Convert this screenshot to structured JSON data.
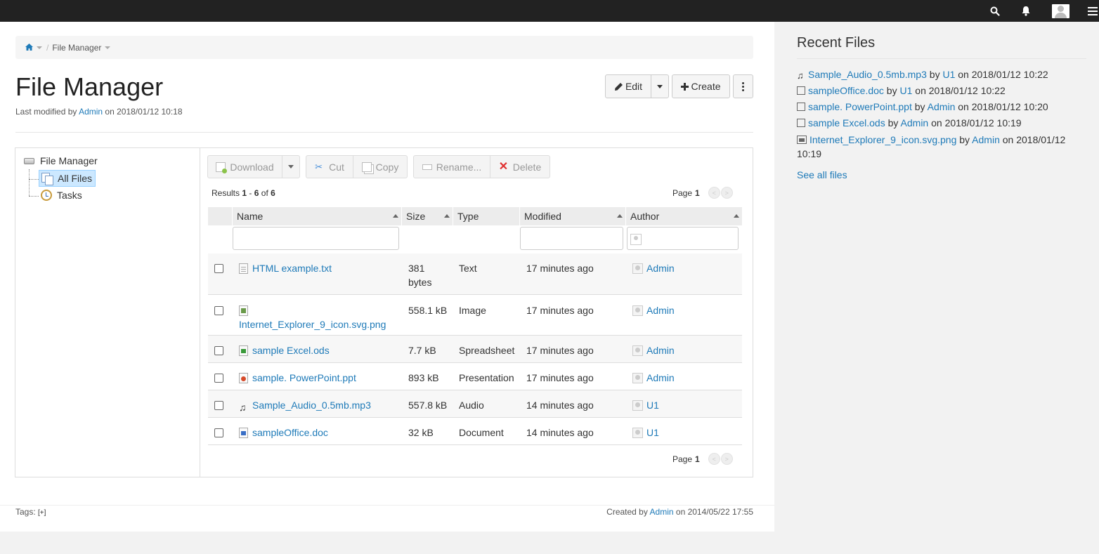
{
  "topbar": {
    "icons": [
      "search-icon",
      "bell-icon",
      "user-avatar",
      "menu-icon"
    ]
  },
  "breadcrumb": {
    "home_icon": "home-icon",
    "separator": "/",
    "current": "File Manager"
  },
  "page": {
    "title": "File Manager",
    "lastmod_prefix": "Last modified by",
    "lastmod_user": "Admin",
    "lastmod_suffix": "on 2018/01/12 10:18"
  },
  "actions": {
    "edit": "Edit",
    "create": "Create"
  },
  "tree": {
    "root": "File Manager",
    "items": [
      {
        "label": "All Files",
        "icon": "files-icon",
        "selected": true
      },
      {
        "label": "Tasks",
        "icon": "clock-icon",
        "selected": false
      }
    ]
  },
  "toolbar": {
    "download": "Download",
    "cut": "Cut",
    "copy": "Copy",
    "rename": "Rename...",
    "delete": "Delete"
  },
  "results": {
    "prefix": "Results",
    "from": "1",
    "dash": "-",
    "to": "6",
    "of": "of",
    "total": "6"
  },
  "pager": {
    "label": "Page",
    "page": "1",
    "prev": "<",
    "next": ">"
  },
  "table": {
    "columns": [
      "Name",
      "Size",
      "Type",
      "Modified",
      "Author"
    ],
    "rows": [
      {
        "name": "HTML example.txt",
        "icon": "txt",
        "size": "381 bytes",
        "type": "Text",
        "modified": "17 minutes ago",
        "author": "Admin"
      },
      {
        "name": "Internet_Explorer_9_icon.svg.png",
        "icon": "img",
        "size": "558.1 kB",
        "type": "Image",
        "modified": "17 minutes ago",
        "author": "Admin"
      },
      {
        "name": "sample Excel.ods",
        "icon": "xls",
        "size": "7.7 kB",
        "type": "Spreadsheet",
        "modified": "17 minutes ago",
        "author": "Admin"
      },
      {
        "name": "sample. PowerPoint.ppt",
        "icon": "ppt",
        "size": "893 kB",
        "type": "Presentation",
        "modified": "17 minutes ago",
        "author": "Admin"
      },
      {
        "name": "Sample_Audio_0.5mb.mp3",
        "icon": "mp3",
        "size": "557.8 kB",
        "type": "Audio",
        "modified": "14 minutes ago",
        "author": "U1"
      },
      {
        "name": "sampleOffice.doc",
        "icon": "doc",
        "size": "32 kB",
        "type": "Document",
        "modified": "14 minutes ago",
        "author": "U1"
      }
    ]
  },
  "footer": {
    "tags_label": "Tags:",
    "tags_add": "[+]",
    "created_prefix": "Created by",
    "created_user": "Admin",
    "created_suffix": "on 2014/05/22 17:55"
  },
  "sidebar": {
    "title": "Recent Files",
    "items": [
      {
        "icon": "music-icon",
        "file": "Sample_Audio_0.5mb.mp3",
        "by": "by",
        "user": "U1",
        "when": "on 2018/01/12 10:22"
      },
      {
        "icon": "doc-icon",
        "file": "sampleOffice.doc",
        "by": "by",
        "user": "U1",
        "when": "on 2018/01/12 10:22"
      },
      {
        "icon": "ppt-icon",
        "file": "sample. PowerPoint.ppt",
        "by": "by",
        "user": "Admin",
        "when": "on 2018/01/12 10:20"
      },
      {
        "icon": "xls-icon",
        "file": "sample Excel.ods",
        "by": "by",
        "user": "Admin",
        "when": "on 2018/01/12 10:19"
      },
      {
        "icon": "image-icon",
        "file": "Internet_Explorer_9_icon.svg.png",
        "by": "by",
        "user": "Admin",
        "when": "on 2018/01/12 10:19"
      }
    ],
    "see_all": "See all files"
  }
}
